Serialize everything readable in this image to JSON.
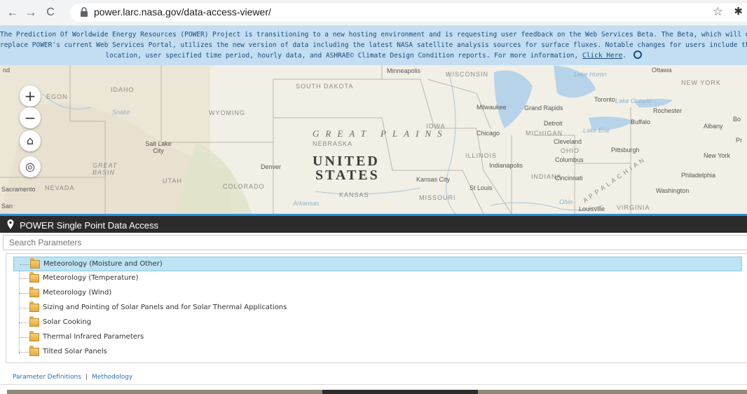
{
  "browser": {
    "back": "←",
    "forward": "→",
    "reload": "C",
    "url": "power.larc.nasa.gov/data-access-viewer/",
    "star": "☆",
    "extension": "✱"
  },
  "banner": {
    "line1": "The Prediction Of Worldwide Energy Resources (POWER) Project is transitioning to a new hosting environment and is requesting user feedback on the Web Services Beta. The Beta, which will ev",
    "line2": "replace POWER's current Web Services Portal, utilizes the new version of data including the latest NASA satellite analysis sources for surface fluxes. Notable changes for users include the availabilit",
    "line3": "location, user specified time period, hourly data, and ASHRAE© Climate Design Condition reports. For more information,",
    "link": "Click Here",
    "colors": {
      "background": "#c3def3",
      "text": "#1e4a7a"
    }
  },
  "map": {
    "controls": {
      "zoom_in": "+",
      "zoom_out": "−",
      "home": "⌂",
      "locate": "◎"
    },
    "labels": {
      "nd": "nd",
      "oregon": "EGON",
      "idaho": "IDAHO",
      "wyoming": "WYOMING",
      "south_dakota": "SOUTH DAKOTA",
      "minneapolis": "Minneapolis",
      "wisconsin": "WISCONSIN",
      "lake_huron": "Lake Huron",
      "ottawa": "Ottawa",
      "new_york_state": "NEW YORK",
      "snake": "Snake",
      "salt_lake_city": "Salt Lake City",
      "great_plains": "GREAT PLAINS",
      "nebraska": "NEBRASKA",
      "iowa": "IOWA",
      "milwaukee": "Milwaukee",
      "grand_rapids": "Grand Rapids",
      "toronto": "Toronto",
      "lake_ontario": "Lake Ontario",
      "rochester": "Rochester",
      "chicago": "Chicago",
      "michigan": "MICHIGAN",
      "detroit": "Detroit",
      "lake_erie": "Lake Erie",
      "buffalo": "Buffalo",
      "albany": "Albany",
      "cleveland": "Cleveland",
      "ohio": "OHIO",
      "pittsburgh": "Pittsburgh",
      "new_york_city": "New York",
      "united": "UNITED",
      "states": "STATES",
      "denver": "Denver",
      "illinois": "ILLINOIS",
      "indianapolis": "Indianapolis",
      "columbus": "Columbus",
      "great_basin": "GREAT BASIN",
      "utah": "UTAH",
      "colorado": "COLORADO",
      "kansas_city": "Kansas City",
      "indiana": "INDIANA",
      "cincinnati": "Cincinnati",
      "philadelphia": "Philadelphia",
      "sacramento": "Sacramento",
      "nevada": "NEVADA",
      "kansas": "KANSAS",
      "missouri": "MISSOURI",
      "st_louis": "St Louis",
      "washington": "Washington",
      "louisville": "Louisville",
      "virginia": "VIRGINIA",
      "san": "San",
      "arkansas": "Arkansas",
      "ohio_river": "Ohio",
      "bo": "Bo",
      "pr": "Pr",
      "appalachian": "A P P A L A C H I A N"
    }
  },
  "panel": {
    "title": "POWER Single Point Data Access",
    "search_placeholder": "Search Parameters"
  },
  "tree": {
    "items": [
      {
        "label": "Meteorology (Moisture and Other)",
        "selected": true
      },
      {
        "label": "Meteorology (Temperature)"
      },
      {
        "label": "Meteorology (Wind)"
      },
      {
        "label": "Sizing and Pointing of Solar Panels and for Solar Thermal Applications"
      },
      {
        "label": "Solar Cooking"
      },
      {
        "label": "Thermal Infrared Parameters"
      },
      {
        "label": "Tilted Solar Panels"
      }
    ]
  },
  "footer": {
    "parameter_definitions": "Parameter Definitions",
    "separator": "|",
    "methodology": "Methodology"
  }
}
